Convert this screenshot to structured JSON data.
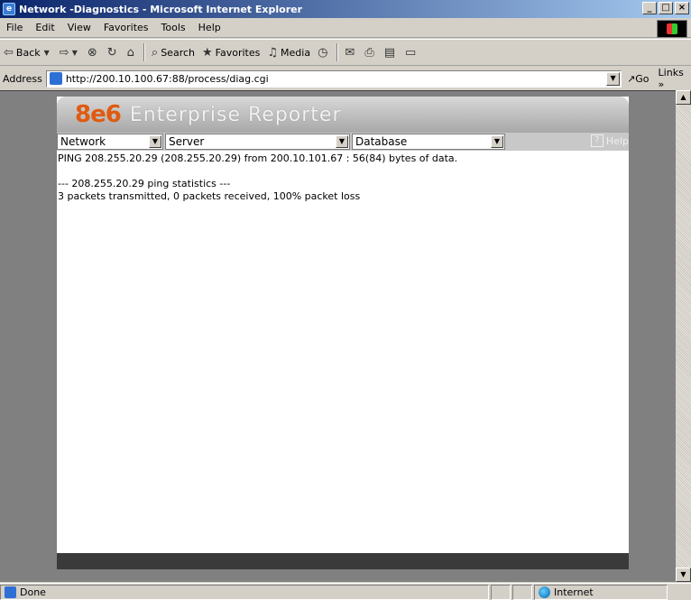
{
  "window": {
    "title": "Network -Diagnostics - Microsoft Internet Explorer",
    "min": "_",
    "max": "□",
    "close": "×"
  },
  "menu": [
    "File",
    "Edit",
    "View",
    "Favorites",
    "Tools",
    "Help"
  ],
  "toolbar": {
    "back": "Back",
    "search": "Search",
    "favorites": "Favorites",
    "media": "Media"
  },
  "address": {
    "label": "Address",
    "url": "http://200.10.100.67:88/process/diag.cgi",
    "go": "Go",
    "links": "Links"
  },
  "app": {
    "logo_num": "8e6",
    "logo_text": "Enterprise Reporter",
    "selects": [
      "Network",
      "Server",
      "Database"
    ],
    "help": "Help"
  },
  "output": {
    "line1": "PING 208.255.20.29 (208.255.20.29) from 200.10.101.67 : 56(84) bytes of data.",
    "line2": "",
    "line3": "--- 208.255.20.29 ping statistics ---",
    "line4": "3 packets transmitted, 0 packets received, 100% packet loss"
  },
  "status": {
    "text": "Done",
    "zone": "Internet"
  }
}
